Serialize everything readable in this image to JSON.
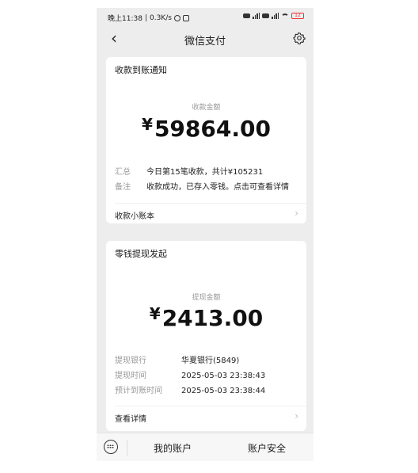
{
  "status_bar": {
    "time": "晚上11:38",
    "speed": "0.3K/s"
  },
  "nav": {
    "title": "微信支付"
  },
  "card1": {
    "title": "收款到账通知",
    "amount_label": "收款金额",
    "currency": "¥",
    "amount": "59864.00",
    "rows": [
      {
        "key": "汇总",
        "value": "今日第15笔收款，共计¥105231"
      },
      {
        "key": "备注",
        "value": "收款成功，已存入零钱。点击可查看详情"
      }
    ],
    "footer": "收款小账本"
  },
  "card2": {
    "title": "零钱提现发起",
    "amount_label": "提现金额",
    "currency": "¥",
    "amount": "2413.00",
    "rows": [
      {
        "key": "提现银行",
        "value": "华夏银行(5849)"
      },
      {
        "key": "提现时间",
        "value": "2025-05-03 23:38:43"
      },
      {
        "key": "预计到账时间",
        "value": "2025-05-03 23:38:44"
      }
    ],
    "footer": "查看详情"
  },
  "bottom_bar": {
    "tab1": "我的账户",
    "tab2": "账户安全"
  },
  "icons": {
    "back": "chevron-left-icon",
    "settings": "gear-icon",
    "keyboard": "keyboard-icon",
    "chevron": "chevron-right-icon"
  },
  "colors": {
    "page_bg": "#ededed",
    "card_bg": "#ffffff",
    "muted_text": "#999999",
    "battery": "#e33333"
  }
}
